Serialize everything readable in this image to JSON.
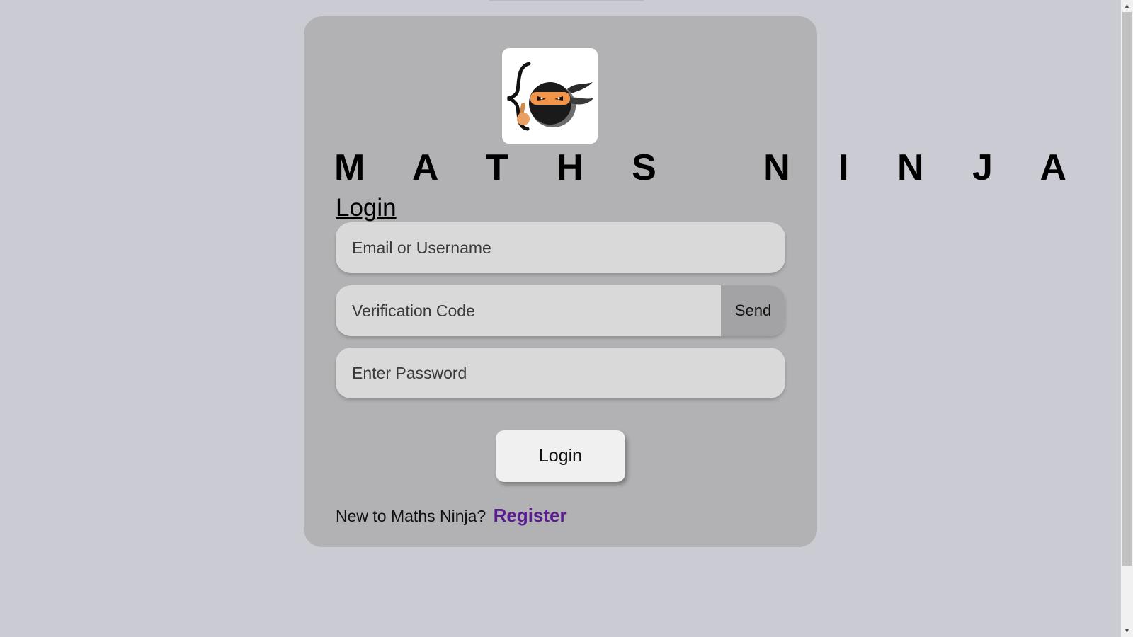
{
  "app": {
    "brand_title": "M A T H S   N I N J A",
    "logo_icon": "ninja-logo-icon"
  },
  "form": {
    "heading": "Login",
    "email_placeholder": "Email or Username",
    "code_placeholder": "Verification Code",
    "send_label": "Send",
    "password_placeholder": "Enter Password",
    "submit_label": "Login"
  },
  "footer": {
    "prompt": "New to Maths Ninja?",
    "register_label": "Register"
  },
  "colors": {
    "page_background": "#cbcbd3",
    "card_background": "#b2b2b4",
    "input_background": "#d9d9da",
    "send_button": "#a3a3a5",
    "link": "#5a1d91"
  },
  "scrollbar": {
    "up_icon": "chevron-up-icon",
    "down_icon": "chevron-down-icon"
  }
}
